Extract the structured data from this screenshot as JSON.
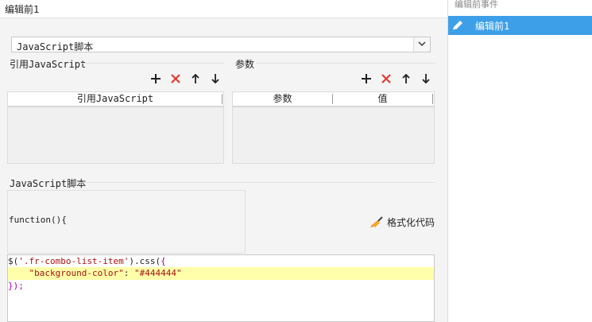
{
  "header": {
    "title": "编辑前1"
  },
  "script_type_select": {
    "value": "JavaScript脚本"
  },
  "ref_section": {
    "label": "引用JavaScript",
    "table_header": "引用JavaScript"
  },
  "param_section": {
    "label": "参数",
    "columns": [
      "参数",
      "值"
    ]
  },
  "script_section": {
    "label": "JavaScript脚本",
    "signature": "function(){",
    "format_label": "格式化代码"
  },
  "code": {
    "line1_a": "$(",
    "line1_b": "'.fr-combo-list-item'",
    "line1_c": ").css(",
    "line1_d": "{",
    "line2_indent": "    ",
    "line2_key": "\"background-color\"",
    "line2_colon": ": ",
    "line2_val": "\"#444444\"",
    "line3_a": "}",
    "line3_b": ");",
    "line3_c": "});"
  },
  "sidebar": {
    "title": "编辑前事件",
    "items": [
      {
        "label": "编辑前1",
        "icon": "pencil-icon"
      }
    ]
  },
  "colors": {
    "accent": "#3e9fe9",
    "delete": "#e53935",
    "highlight": "#ffffaa",
    "string": "#aa1111",
    "bracket": "#aa00aa"
  }
}
